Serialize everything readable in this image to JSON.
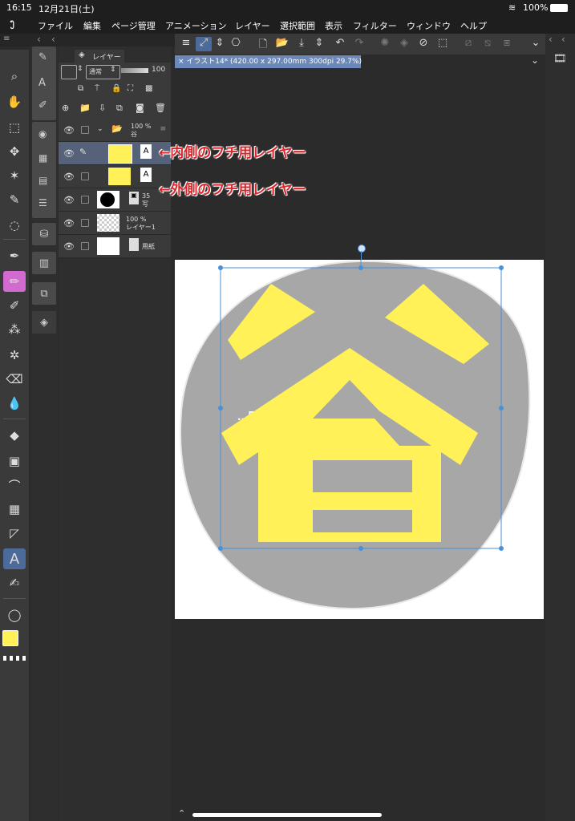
{
  "status": {
    "time": "16:15",
    "date": "12月21日(土)",
    "battery": "100%"
  },
  "menu": [
    "ファイル",
    "編集",
    "ページ管理",
    "アニメーション",
    "レイヤー",
    "選択範囲",
    "表示",
    "フィルター",
    "ウィンドウ",
    "ヘルプ"
  ],
  "layer_panel": {
    "tab_label": "レイヤー",
    "blend_mode": "通常",
    "opacity": "100",
    "layers": [
      {
        "percent": "100 %",
        "name": "谷",
        "kind": "folder"
      },
      {
        "percent": "",
        "name": "",
        "kind": "text-selected"
      },
      {
        "percent": "",
        "name": "",
        "kind": "text"
      },
      {
        "percent": "35",
        "name": "写",
        "kind": "raster-black"
      },
      {
        "percent": "100 %",
        "name": "レイヤー1",
        "kind": "raster"
      },
      {
        "percent": "",
        "name": "用紙",
        "kind": "paper"
      }
    ]
  },
  "document": {
    "tab": "イラスト14* (420.00 x 297.00mm 300dpi 29.7%)"
  },
  "canvas": {
    "character": "谷",
    "hidden_text": "...5cm",
    "colors": {
      "blob": "#a7a7a7",
      "glyph": "#fff157",
      "handle": "#4a90d9"
    }
  },
  "annotations": {
    "inner": "←内側のフチ用レイヤー",
    "outer": "←外側のフチ用レイヤー"
  },
  "colors": {
    "main": "#fff157",
    "sub": "#ffffff",
    "accent": "#d8262c"
  }
}
